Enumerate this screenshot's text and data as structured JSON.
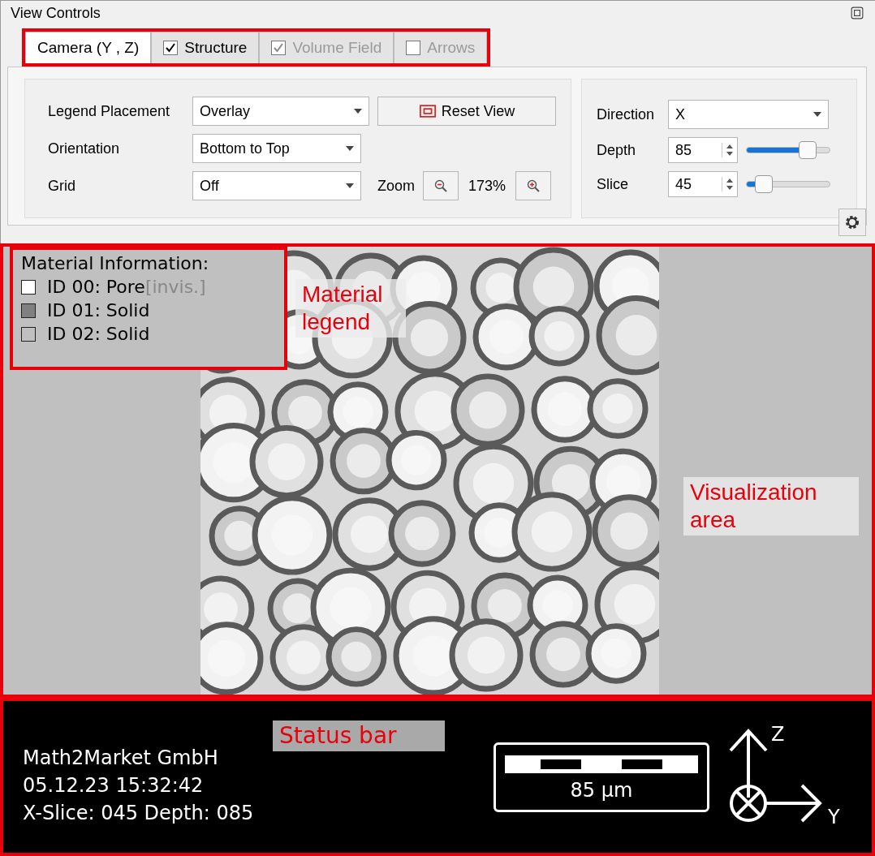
{
  "window": {
    "title": "View Controls"
  },
  "tabs": [
    {
      "label": "Camera (Y , Z)",
      "kind": "plain",
      "selected": true,
      "disabled": false
    },
    {
      "label": "Structure",
      "kind": "checkbox",
      "selected": false,
      "checked": true,
      "disabled": false
    },
    {
      "label": "Volume Field",
      "kind": "checkbox",
      "selected": false,
      "checked": true,
      "disabled": true
    },
    {
      "label": "Arrows",
      "kind": "checkbox",
      "selected": false,
      "checked": false,
      "disabled": true
    }
  ],
  "camera": {
    "legend_placement": {
      "label": "Legend Placement",
      "value": "Overlay"
    },
    "reset_button": "Reset View",
    "orientation": {
      "label": "Orientation",
      "value": "Bottom to Top"
    },
    "grid": {
      "label": "Grid",
      "value": "Off"
    },
    "zoom": {
      "label": "Zoom",
      "value": "173%"
    }
  },
  "slice": {
    "direction": {
      "label": "Direction",
      "value": "X"
    },
    "depth": {
      "label": "Depth",
      "value": "85",
      "level": 0.72
    },
    "slice": {
      "label": "Slice",
      "value": "45",
      "level": 0.2
    }
  },
  "legend": {
    "title": "Material Information:",
    "items": [
      {
        "label": "ID 00: Pore",
        "suffix": "[invis.]",
        "color": "#ffffff"
      },
      {
        "label": "ID 01: Solid",
        "color": "#808080"
      },
      {
        "label": "ID 02: Solid",
        "color": "#c0c0c0"
      }
    ],
    "annotation": "Material legend"
  },
  "visualization": {
    "annotation": "Visualization area"
  },
  "status_bar": {
    "lines": [
      "Math2Market GmbH",
      "05.12.23 15:32:42",
      "X-Slice: 045 Depth: 085"
    ],
    "scale": "85 µm",
    "axis_up": "Z",
    "axis_right": "Y",
    "annotation": "Status bar"
  }
}
